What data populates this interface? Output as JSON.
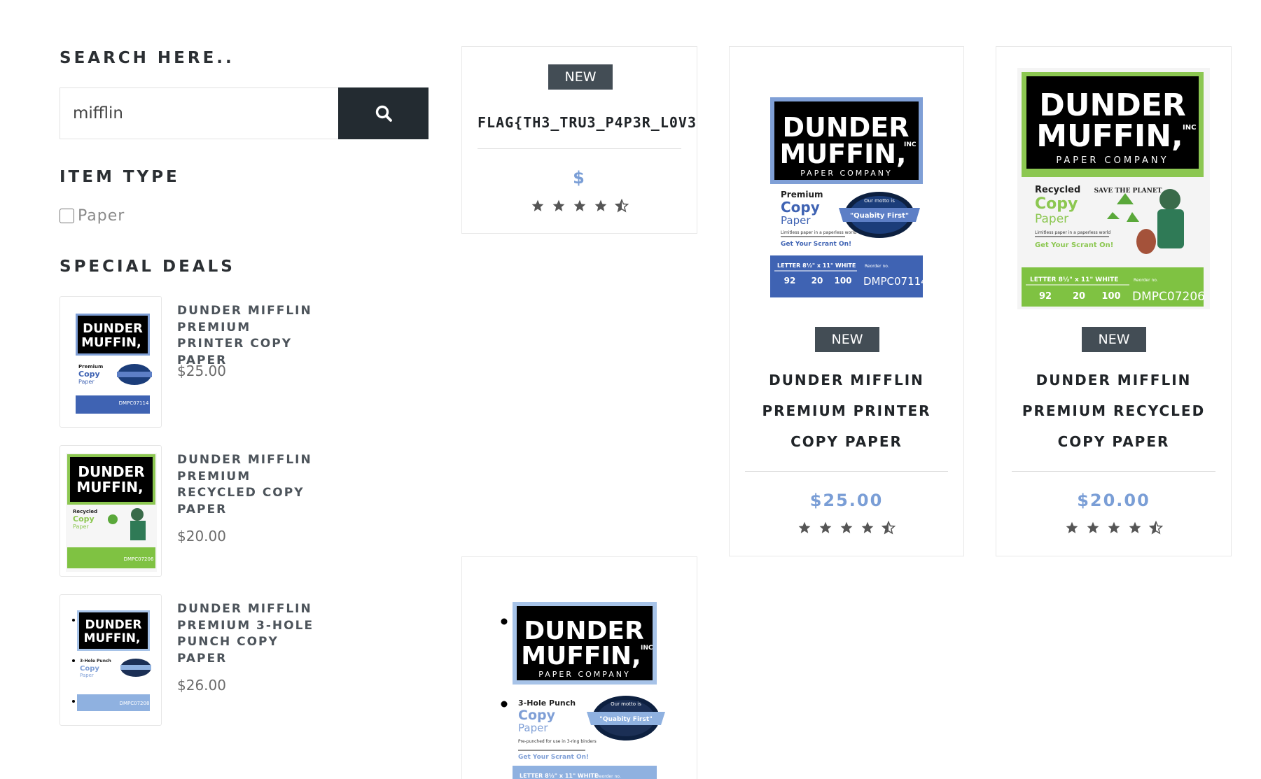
{
  "sidebar": {
    "search_heading": "SEARCH HERE..",
    "search_value": "mifflin",
    "item_type_heading": "ITEM TYPE",
    "item_type_option": "Paper",
    "special_deals_heading": "SPECIAL DEALS",
    "deals": [
      {
        "title": "DUNDER MIFFLIN PREMIUM PRINTER COPY PAPER",
        "price": "$25.00"
      },
      {
        "title": "DUNDER MIFFLIN PREMIUM RECYCLED COPY PAPER",
        "price": "$20.00"
      },
      {
        "title": "DUNDER MIFFLIN PREMIUM 3-HOLE PUNCH COPY PAPER",
        "price": "$26.00"
      }
    ]
  },
  "products": [
    {
      "badge": "NEW",
      "title": "FLAG{TH3_TRU3_P4P3R_L0V3R}",
      "price": "$",
      "rating": 4.5
    },
    {
      "badge": "NEW",
      "title": "DUNDER MIFFLIN PREMIUM PRINTER COPY PAPER",
      "price": "$25.00",
      "rating": 4.5
    },
    {
      "badge": "NEW",
      "title": "DUNDER MIFFLIN PREMIUM RECYCLED COPY PAPER",
      "price": "$20.00",
      "rating": 4.5
    }
  ],
  "packages": {
    "brand_line1": "DUNDER",
    "brand_line2": "MUFFIN,",
    "brand_inc": "INC",
    "brand_sub": "PAPER COMPANY",
    "seal_top": "Our motto is",
    "seal_main": "\"Quabity First\"",
    "tagline": "Get Your Scrant On!",
    "printer": {
      "label1": "Premium",
      "label2": "Copy",
      "label3": "Paper",
      "desc": "Limitless paper in a paperless world",
      "sku": "DMPC07114",
      "spec": "LETTER 8½\" x 11\" WHITE"
    },
    "recycled": {
      "label1": "Recycled",
      "label2": "Copy",
      "label3": "Paper",
      "desc": "Limitless paper in a paperless world",
      "sku": "DMPC07206",
      "spec": "LETTER 8½\" x 11\" WHITE",
      "save": "SAVE THE PLANET"
    },
    "punch": {
      "label1": "3-Hole Punch",
      "label2": "Copy",
      "label3": "Paper",
      "desc": "Pre-punched for use in 3-ring binders",
      "sku": "DMPC07208",
      "spec": "LETTER 8½\" x 11\" WHITE"
    },
    "stats": [
      "92",
      "20",
      "100"
    ],
    "reorder": "Reorder no."
  },
  "colors": {
    "printer_accent": "#7f9fd6",
    "printer_band": "#3f63b3",
    "recycled_accent": "#8cc751",
    "recycled_band": "#7fc242",
    "punch_accent": "#a7c3e8",
    "punch_band": "#8fb1e0",
    "price_blue": "#7a9ed6",
    "badge": "#434d55",
    "search_button": "#232b31"
  }
}
